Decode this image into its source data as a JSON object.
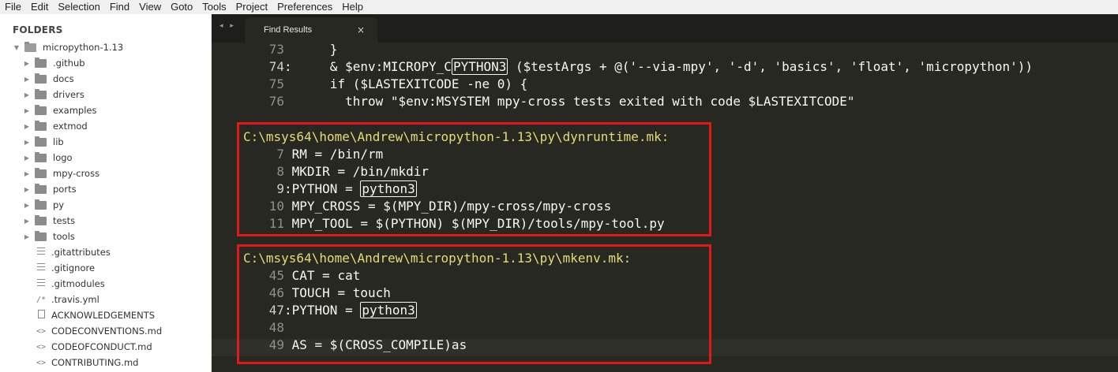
{
  "menu": [
    "File",
    "Edit",
    "Selection",
    "Find",
    "View",
    "Goto",
    "Tools",
    "Project",
    "Preferences",
    "Help"
  ],
  "sidebar": {
    "title": "FOLDERS",
    "root": "micropython-1.13",
    "folders": [
      ".github",
      "docs",
      "drivers",
      "examples",
      "extmod",
      "lib",
      "logo",
      "mpy-cross",
      "ports",
      "py",
      "tests",
      "tools"
    ],
    "files": [
      {
        "name": ".gitattributes",
        "icon": "lines-file-icon"
      },
      {
        "name": ".gitignore",
        "icon": "lines-file-icon"
      },
      {
        "name": ".gitmodules",
        "icon": "lines-file-icon"
      },
      {
        "name": ".travis.yml",
        "icon": "comment-file-icon",
        "glyph": "/*"
      },
      {
        "name": "ACKNOWLEDGEMENTS",
        "icon": "document-file-icon"
      },
      {
        "name": "CODECONVENTIONS.md",
        "icon": "code-file-icon",
        "glyph": "<>"
      },
      {
        "name": "CODEOFCONDUCT.md",
        "icon": "code-file-icon",
        "glyph": "<>"
      },
      {
        "name": "CONTRIBUTING.md",
        "icon": "code-file-icon",
        "glyph": "<>"
      }
    ]
  },
  "tabs": {
    "nav_glyph": "◂ ▸",
    "active_label": "Find Results",
    "close_glyph": "×"
  },
  "editor": {
    "top_block": [
      {
        "num": "73",
        "sep": " ",
        "pre": "     }",
        "hl": "",
        "post": ""
      },
      {
        "num": "74",
        "sep": ":",
        "pre": "     & $env:MICROPY_C",
        "hl": "PYTHON3",
        "post": " ($testArgs + @('--via-mpy', '-d', 'basics', 'float', 'micropython'))"
      },
      {
        "num": "75",
        "sep": " ",
        "pre": "     if ($LASTEXITCODE -ne 0) {",
        "hl": "",
        "post": ""
      },
      {
        "num": "76",
        "sep": " ",
        "pre": "       throw \"$env:MSYSTEM mpy-cross tests exited with code $LASTEXITCODE\"",
        "hl": "",
        "post": ""
      }
    ],
    "results": [
      {
        "path": "C:\\msys64\\home\\Andrew\\micropython-1.13\\py\\dynruntime.mk:",
        "lines": [
          {
            "num": "7",
            "sep": " ",
            "pre": "RM = /bin/rm",
            "hl": "",
            "post": ""
          },
          {
            "num": "8",
            "sep": " ",
            "pre": "MKDIR = /bin/mkdir",
            "hl": "",
            "post": ""
          },
          {
            "num": "9",
            "sep": ":",
            "pre": "PYTHON = ",
            "hl": "python3",
            "post": ""
          },
          {
            "num": "10",
            "sep": " ",
            "pre": "MPY_CROSS = $(MPY_DIR)/mpy-cross/mpy-cross",
            "hl": "",
            "post": ""
          },
          {
            "num": "11",
            "sep": " ",
            "pre": "MPY_TOOL = $(PYTHON) $(MPY_DIR)/tools/mpy-tool.py",
            "hl": "",
            "post": ""
          }
        ]
      },
      {
        "path": "C:\\msys64\\home\\Andrew\\micropython-1.13\\py\\mkenv.mk:",
        "lines": [
          {
            "num": "45",
            "sep": " ",
            "pre": "CAT = cat",
            "hl": "",
            "post": ""
          },
          {
            "num": "46",
            "sep": " ",
            "pre": "TOUCH = touch",
            "hl": "",
            "post": ""
          },
          {
            "num": "47",
            "sep": ":",
            "pre": "PYTHON = ",
            "hl": "python3",
            "post": ""
          },
          {
            "num": "48",
            "sep": " ",
            "pre": "",
            "hl": "",
            "post": ""
          },
          {
            "num": "49",
            "sep": " ",
            "pre": "AS = $(CROSS_COMPILE)as",
            "hl": "",
            "post": ""
          }
        ]
      }
    ],
    "colors": {
      "background": "#272822",
      "path": "#e6db74",
      "text": "#f8f8f2",
      "line_number": "#8f908a",
      "annotation_box": "#e0191a"
    }
  }
}
